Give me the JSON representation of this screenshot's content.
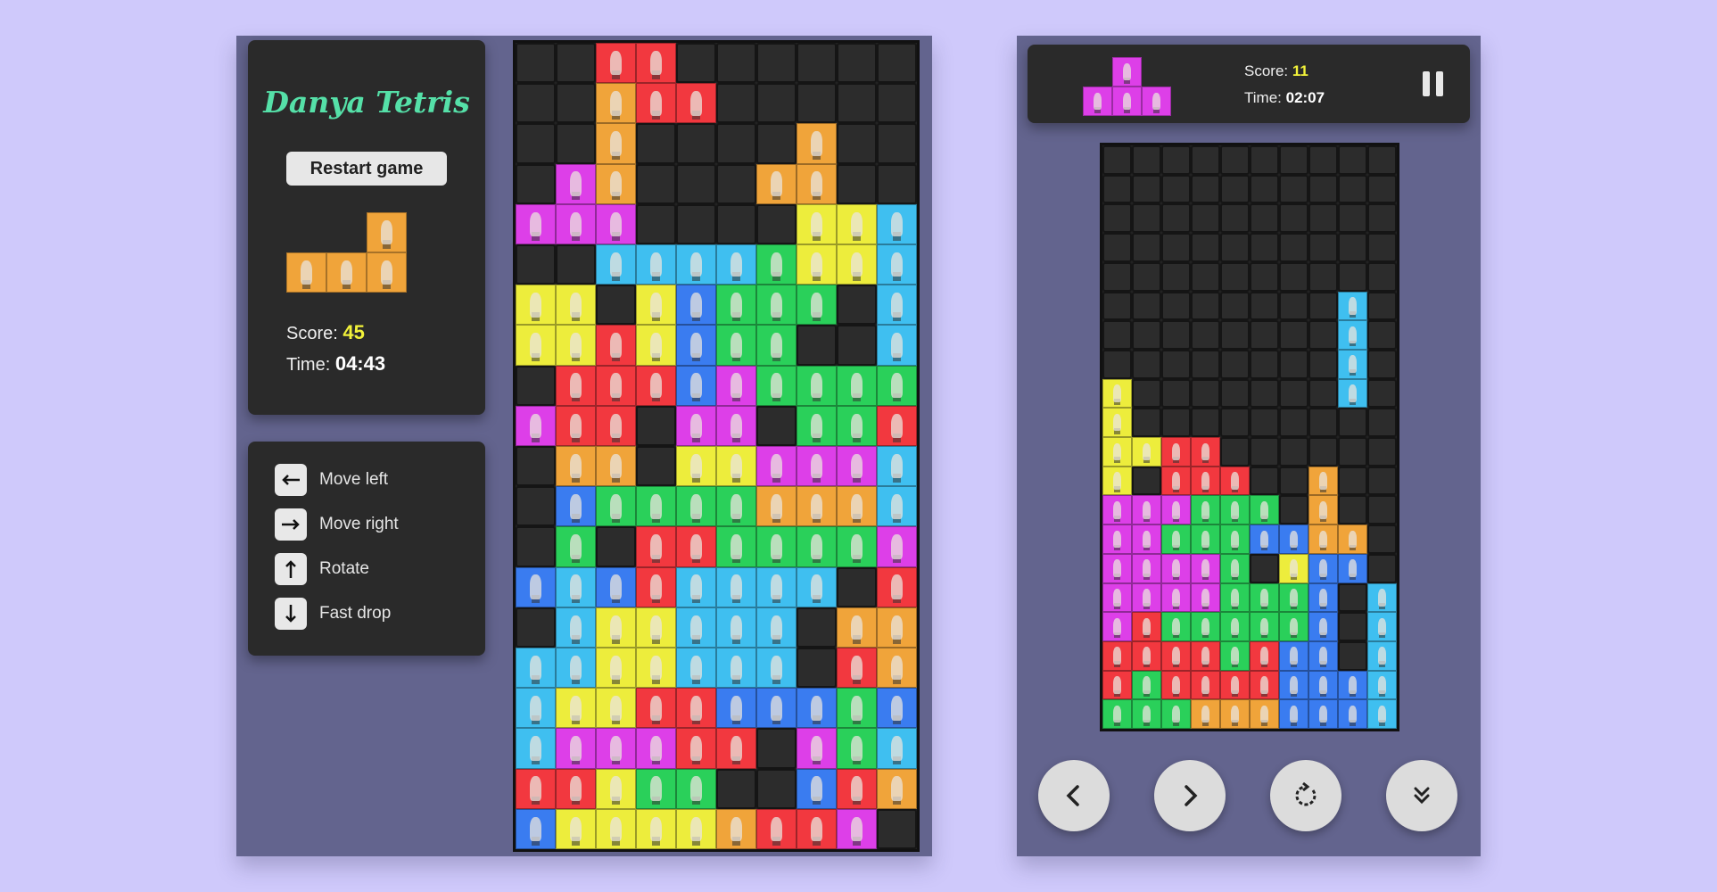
{
  "desktop": {
    "title": "Danya Tetris",
    "restart_label": "Restart game",
    "score_label": "Score:",
    "score_value": "45",
    "time_label": "Time:",
    "time_value": "04:43",
    "next_piece": [
      "",
      "",
      "O",
      "O",
      "O",
      "O"
    ],
    "controls": [
      {
        "icon": "arrow-left-icon",
        "label": "Move left"
      },
      {
        "icon": "arrow-right-icon",
        "label": "Move right"
      },
      {
        "icon": "arrow-up-icon",
        "label": "Rotate"
      },
      {
        "icon": "arrow-down-icon",
        "label": "Fast drop"
      }
    ],
    "board": [
      "..RR......",
      "..ORR.....",
      "..O....O..",
      ".MO...OO..",
      "MMM....YYC",
      "..CCCCGYYC",
      "YY.YBGGG.C",
      "YYRYBGG..C",
      ".RRRBMGGGG",
      "MRR.MM.GGR",
      ".OO.YYMMMC",
      ".BGGGGOOOC",
      ".G.RRGGGGM",
      "BCBRCCCC.R",
      ".CYYCCC.OO",
      "CCYYCCC.RO",
      "CYYRRBBBGB",
      "CMMMRR.MGC",
      "RRYGG..BRO",
      "BYYYYORRM."
    ]
  },
  "mobile": {
    "score_label": "Score:",
    "score_value": "11",
    "time_label": "Time:",
    "time_value": "02:07",
    "next_piece": [
      "",
      "M",
      "",
      "M",
      "M",
      "M"
    ],
    "board": [
      "..........",
      "..........",
      "..........",
      "..........",
      "..........",
      "........C.",
      "........C.",
      "........C.",
      "Y.......C.",
      "Y.........",
      "YYRR......",
      "Y.RRR..O..",
      "MMMGGG.O..",
      "MMGGGBBOO.",
      "MMMMG.YBB.",
      "MMMMGGGB.C",
      "MRGGGGGB.C",
      "RRRRGRBB.C",
      "RGRRRRBBBC",
      "GGGOOOBBBC"
    ],
    "buttons": [
      {
        "name": "mobile-left-button",
        "icon": "chevron-left-icon"
      },
      {
        "name": "mobile-right-button",
        "icon": "chevron-right-icon"
      },
      {
        "name": "mobile-rotate-button",
        "icon": "rotate-icon"
      },
      {
        "name": "mobile-drop-button",
        "icon": "double-chevron-down-icon"
      }
    ]
  },
  "colors": {
    "R": "#f2383f",
    "O": "#f0a43a",
    "Y": "#eded3c",
    "G": "#2ad05a",
    "C": "#3fbff0",
    "B": "#3a7cf0",
    "M": "#dd3fe8"
  }
}
